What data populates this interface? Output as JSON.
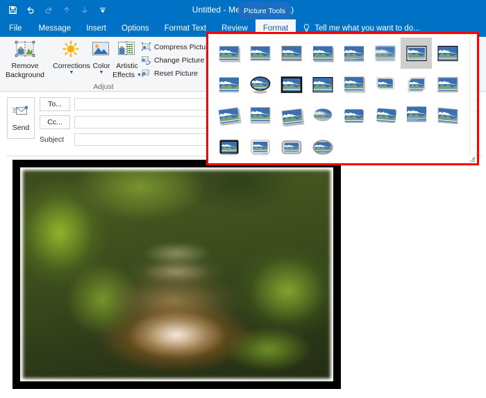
{
  "window": {
    "title": "Untitled - Message (HTML)",
    "contextual_tab_label": "Picture Tools",
    "accent_color": "#0072c6",
    "annotation_color": "#ff0000"
  },
  "quick_access_toolbar": {
    "items": [
      {
        "name": "save-icon",
        "label": "Save",
        "enabled": true
      },
      {
        "name": "undo-icon",
        "label": "Undo",
        "enabled": true
      },
      {
        "name": "redo-icon",
        "label": "Redo",
        "enabled": false
      },
      {
        "name": "move-up-icon",
        "label": "Previous Item",
        "enabled": false
      },
      {
        "name": "move-down-icon",
        "label": "Next Item",
        "enabled": false
      },
      {
        "name": "customize-qat-icon",
        "label": "Customize Quick Access Toolbar",
        "enabled": true
      }
    ]
  },
  "ribbon": {
    "tabs": [
      {
        "label": "File",
        "active": false
      },
      {
        "label": "Message",
        "active": false
      },
      {
        "label": "Insert",
        "active": false
      },
      {
        "label": "Options",
        "active": false
      },
      {
        "label": "Format Text",
        "active": false
      },
      {
        "label": "Review",
        "active": false
      },
      {
        "label": "Format",
        "active": true
      }
    ],
    "tell_me": {
      "icon": "lightbulb-icon",
      "label": "Tell me what you want to do..."
    },
    "groups": [
      {
        "name": "adjust",
        "label": "Adjust",
        "big_buttons": [
          {
            "label_line1": "Remove",
            "label_line2": "Background",
            "icon": "remove-background-icon",
            "has_caret": false
          },
          {
            "label_line1": "Corrections",
            "label_line2": "",
            "icon": "corrections-icon",
            "has_caret": true
          },
          {
            "label_line1": "Color",
            "label_line2": "",
            "icon": "color-icon",
            "has_caret": true
          },
          {
            "label_line1": "Artistic",
            "label_line2": "Effects",
            "icon": "artistic-effects-icon",
            "has_caret": true
          }
        ],
        "small_buttons": [
          {
            "label": "Compress Pictures",
            "icon": "compress-pictures-icon",
            "has_caret": false
          },
          {
            "label": "Change Picture",
            "icon": "change-picture-icon",
            "has_caret": false
          },
          {
            "label": "Reset Picture",
            "icon": "reset-picture-icon",
            "has_caret": true
          }
        ]
      }
    ]
  },
  "picture_styles_gallery": {
    "name": "picture-styles-gallery",
    "columns": 8,
    "rows": 4,
    "count": 28,
    "selected_index": 6,
    "items": [
      {
        "index": 0,
        "label": "Simple Frame, White"
      },
      {
        "index": 1,
        "label": "Beveled Matte, White"
      },
      {
        "index": 2,
        "label": "Metal Frame"
      },
      {
        "index": 3,
        "label": "Drop Shadow Rectangle"
      },
      {
        "index": 4,
        "label": "Reflected Rounded Rectangle"
      },
      {
        "index": 5,
        "label": "Soft Edge Rectangle"
      },
      {
        "index": 6,
        "label": "Double Frame, Black"
      },
      {
        "index": 7,
        "label": "Thick Matte, Black"
      },
      {
        "index": 8,
        "label": "Simple Frame, Black"
      },
      {
        "index": 9,
        "label": "Beveled Oval, Black"
      },
      {
        "index": 10,
        "label": "Compound Frame, Black"
      },
      {
        "index": 11,
        "label": "Moderate Frame, Black"
      },
      {
        "index": 12,
        "label": "Center Shadow Rectangle"
      },
      {
        "index": 13,
        "label": "Rounded Diagonal Corner, White"
      },
      {
        "index": 14,
        "label": "Snip Diagonal Corner, White"
      },
      {
        "index": 15,
        "label": "Moderate Frame, White"
      },
      {
        "index": 16,
        "label": "Rotated, White"
      },
      {
        "index": 17,
        "label": "Perspective Shadow, White"
      },
      {
        "index": 18,
        "label": "Relaxed Perspective, White"
      },
      {
        "index": 19,
        "label": "Soft Edge Oval"
      },
      {
        "index": 20,
        "label": "Bevel Rectangle"
      },
      {
        "index": 21,
        "label": "Bevel Perspective"
      },
      {
        "index": 22,
        "label": "Reflected Perspective Right"
      },
      {
        "index": 23,
        "label": "Bevel Perspective Left, White"
      },
      {
        "index": 24,
        "label": "Reflected Bevel, Black"
      },
      {
        "index": 25,
        "label": "Reflected Bevel, White"
      },
      {
        "index": 26,
        "label": "Metal Rounded Rectangle"
      },
      {
        "index": 27,
        "label": "Metal Oval"
      }
    ],
    "resize_grip": "resize-grip-icon"
  },
  "message_header": {
    "send_button": {
      "label": "Send",
      "icon": "send-envelope-icon"
    },
    "fields": [
      {
        "name": "to",
        "label": "To...",
        "value": "",
        "is_button": true
      },
      {
        "name": "cc",
        "label": "Cc...",
        "value": "",
        "is_button": true
      },
      {
        "name": "subject",
        "label": "Subject",
        "value": "",
        "is_button": false
      }
    ]
  },
  "message_body": {
    "attached_picture": {
      "name": "attached-photo",
      "alt": "Blurred photo of a wooden footbridge in a green forest",
      "applied_style": "Double Frame, Black"
    }
  }
}
